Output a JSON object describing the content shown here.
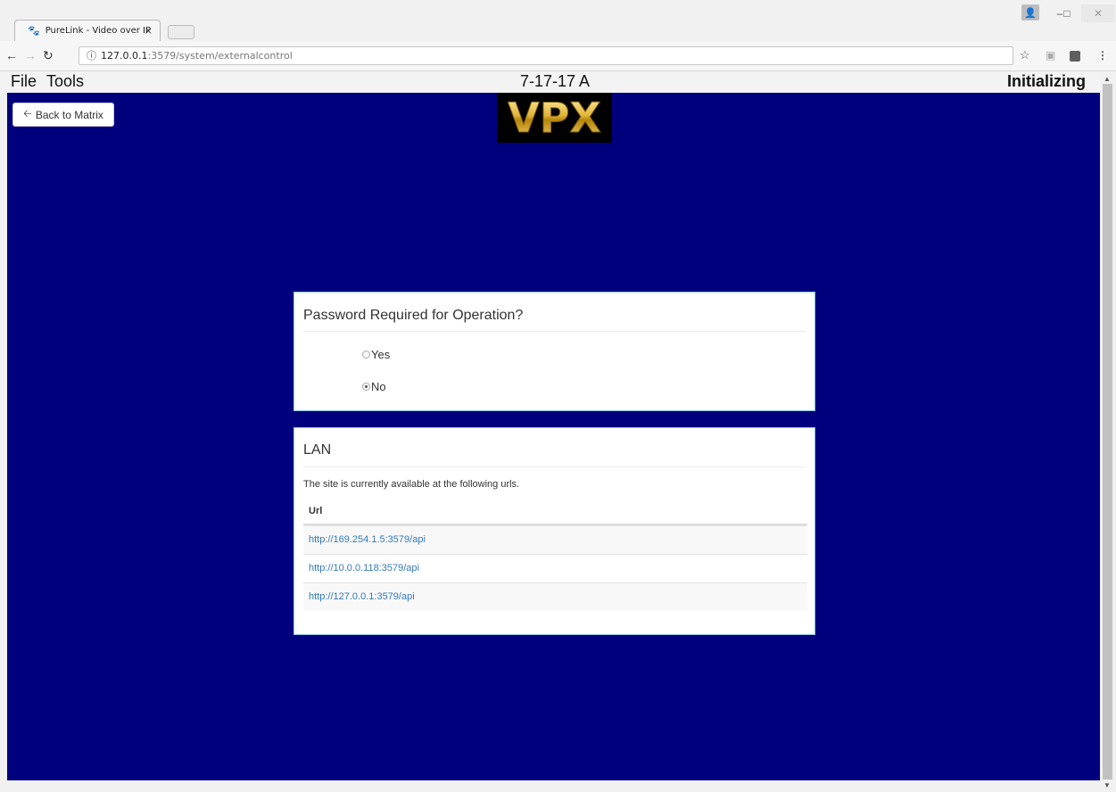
{
  "browser": {
    "tab_title": "PureLink - Video over IP",
    "tab_close": "×",
    "url_host": "127.0.0.1",
    "url_rest": ":3579/system/externalcontrol"
  },
  "menu": {
    "file": "File",
    "tools": "Tools"
  },
  "header": {
    "version": "7-17-17 A",
    "status": "Initializing"
  },
  "page": {
    "back_button": "Back to Matrix",
    "logo_text": "VPX",
    "password_panel": {
      "title": "Password Required for Operation?",
      "options": [
        {
          "label": "Yes",
          "checked": false
        },
        {
          "label": "No",
          "checked": true
        }
      ]
    },
    "lan_panel": {
      "title": "LAN",
      "description": "The site is currently available at the following urls.",
      "column_header": "Url",
      "urls": [
        "http://169.254.1.5:3579/api",
        "http://10.0.0.118:3579/api",
        "http://127.0.0.1:3579/api"
      ]
    }
  },
  "icons": {
    "back": "arrow-left-icon",
    "radio": "radio-icon"
  },
  "colors": {
    "page_background": "#00007f",
    "link": "#337ab7",
    "panel_border": "#8fc5e6"
  }
}
